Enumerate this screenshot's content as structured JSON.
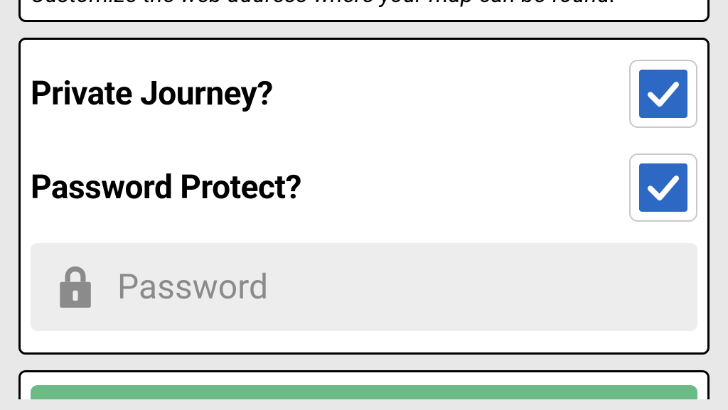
{
  "helper_text": "Customize the web address where your map can be found.",
  "options": {
    "private_journey": {
      "label": "Private Journey?"
    },
    "password_protect": {
      "label": "Password Protect?"
    }
  },
  "password": {
    "placeholder": "Password",
    "value": ""
  },
  "colors": {
    "checkbox_fill": "#2c68c4",
    "green_button": "#6bbb86"
  }
}
